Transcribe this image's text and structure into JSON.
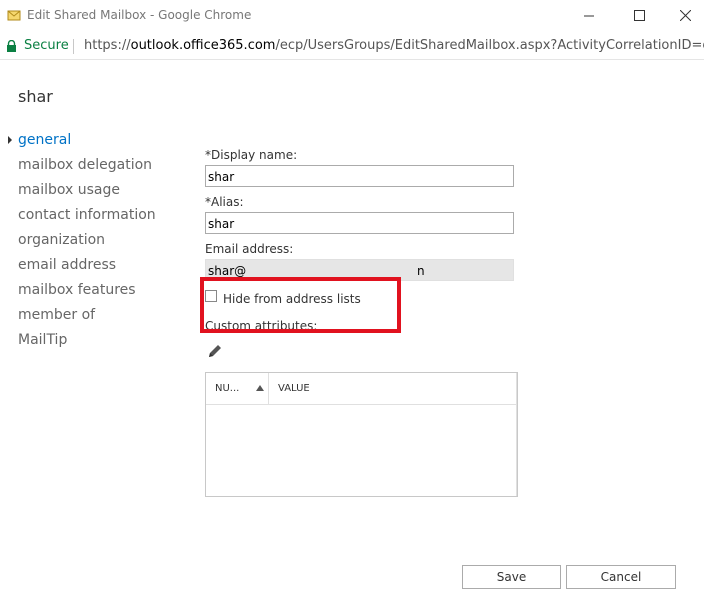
{
  "window": {
    "title": "Edit Shared Mailbox - Google Chrome",
    "controls": {
      "minimize": "minimize",
      "maximize": "maximize",
      "close": "close"
    }
  },
  "addressbar": {
    "secure_label": "Secure",
    "url_prefix": "https://",
    "url_host": "outlook.office365.com",
    "url_path": "/ecp/UsersGroups/EditSharedMailbox.aspx?ActivityCorrelationID=e4..."
  },
  "page": {
    "title": "shar"
  },
  "nav": {
    "items": [
      {
        "label": "general",
        "selected": true
      },
      {
        "label": "mailbox delegation",
        "selected": false
      },
      {
        "label": "mailbox usage",
        "selected": false
      },
      {
        "label": "contact information",
        "selected": false
      },
      {
        "label": "organization",
        "selected": false
      },
      {
        "label": "email address",
        "selected": false
      },
      {
        "label": "mailbox features",
        "selected": false
      },
      {
        "label": "member of",
        "selected": false
      },
      {
        "label": "MailTip",
        "selected": false
      }
    ]
  },
  "form": {
    "display_name_label": "*Display name:",
    "display_name_value": "shar",
    "alias_label": "*Alias:",
    "alias_value": "shar",
    "email_label": "Email address:",
    "email_value_visible": "shar@",
    "email_value_tail": "n",
    "hide_checkbox_label": "Hide from address lists",
    "hide_checked": false,
    "custom_attributes_label": "Custom attributes:",
    "table": {
      "columns": [
        "NU...",
        "VALUE"
      ],
      "rows": []
    }
  },
  "buttons": {
    "save": "Save",
    "cancel": "Cancel"
  },
  "colors": {
    "accent": "#0072c6",
    "secure_green": "#0b8043",
    "highlight_red": "#e1121f"
  }
}
